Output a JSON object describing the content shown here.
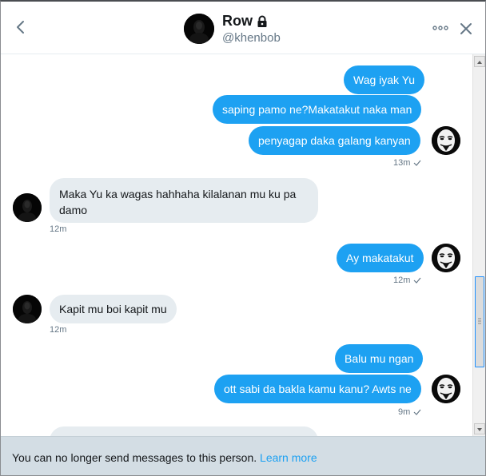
{
  "header": {
    "name": "Row",
    "handle": "@khenbob",
    "icons": [
      "back-arrow-icon",
      "lock-icon",
      "more-dots-icon",
      "close-icon"
    ]
  },
  "messages": [
    {
      "side": "sent",
      "text": "Wag iyak Yu"
    },
    {
      "side": "sent",
      "text": "saping pamo ne?Makatakut naka man"
    },
    {
      "side": "sent",
      "text": "penyagap daka galang kanyan",
      "time": "13m"
    },
    {
      "side": "received",
      "text": "Maka Yu ka wagas hahhaha kilalanan mu ku pa damo",
      "time": "12m"
    },
    {
      "side": "sent",
      "text": "Ay makatakut",
      "time": "12m"
    },
    {
      "side": "received",
      "text": "Kapit mu boi  kapit mu",
      "time": "12m"
    },
    {
      "side": "sent",
      "text": "Balu mu ngan"
    },
    {
      "side": "sent",
      "text": "ott sabi da bakla kamu kanu? Awts ne",
      "time": "9m"
    }
  ],
  "notice": {
    "text": "You can no longer send messages to this person.",
    "link": "Learn more"
  },
  "colors": {
    "sent_bubble": "#1da1f2",
    "received_bubble": "#e6ecf0",
    "notice_bg": "#d3dde4",
    "link": "#1da1f2"
  }
}
